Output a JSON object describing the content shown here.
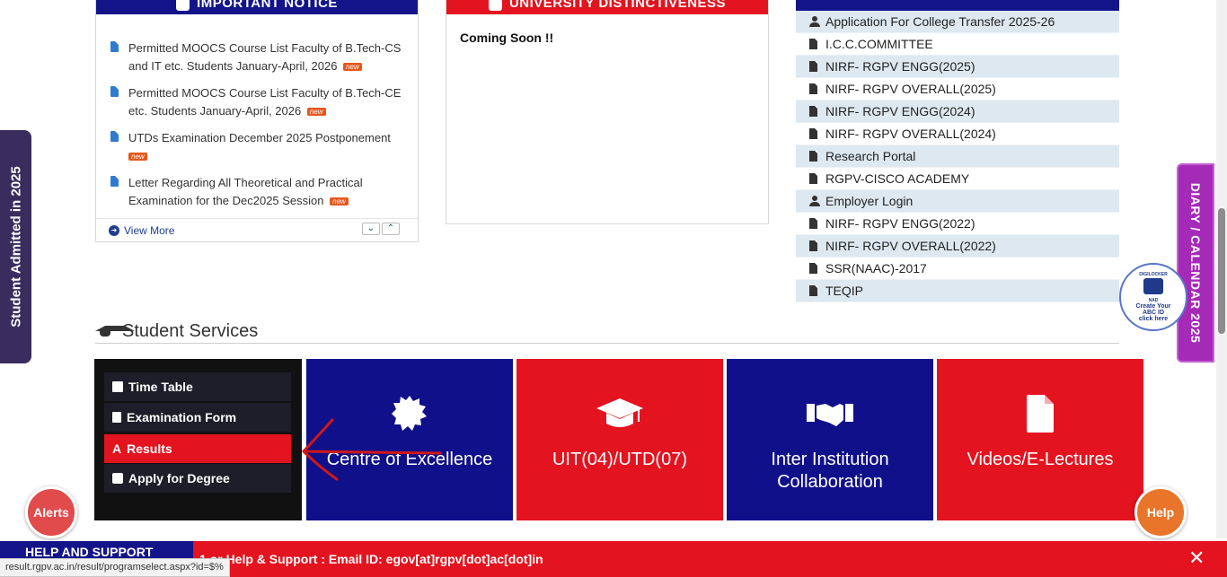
{
  "notice_panel": {
    "title": "IMPORTANT NOTICE",
    "items": [
      {
        "text": "Permitted MOOCS Course List Faculty of B.Tech-CS and IT etc. Students January-April, 2026",
        "badge": "new"
      },
      {
        "text": "Permitted MOOCS Course List Faculty of B.Tech-CE etc. Students January-April, 2026",
        "badge": "new"
      },
      {
        "text": "UTDs Examination December 2025 Postponement",
        "badge": "new"
      },
      {
        "text": "Letter Regarding All Theoretical and Practical Examination for the Dec2025 Session",
        "badge": "new"
      }
    ],
    "view_more": "View More"
  },
  "distinct_panel": {
    "title": "UNIVERSITY DISTINCTIVENESS",
    "content": "Coming Soon !!"
  },
  "links": [
    {
      "label": "Application For College Transfer 2025-26",
      "icon": "user-icon"
    },
    {
      "label": "I.C.C.COMMITTEE",
      "icon": "file-icon"
    },
    {
      "label": "NIRF- RGPV ENGG(2025)",
      "icon": "file-icon"
    },
    {
      "label": "NIRF- RGPV OVERALL(2025)",
      "icon": "file-icon"
    },
    {
      "label": "NIRF- RGPV ENGG(2024)",
      "icon": "file-icon"
    },
    {
      "label": "NIRF- RGPV OVERALL(2024)",
      "icon": "file-icon"
    },
    {
      "label": "Research Portal",
      "icon": "file-icon"
    },
    {
      "label": "RGPV-CISCO ACADEMY",
      "icon": "file-icon"
    },
    {
      "label": "Employer Login",
      "icon": "user-icon"
    },
    {
      "label": "NIRF- RGPV ENGG(2022)",
      "icon": "file-icon"
    },
    {
      "label": "NIRF- RGPV OVERALL(2022)",
      "icon": "file-icon"
    },
    {
      "label": "SSR(NAAC)-2017",
      "icon": "file-icon"
    },
    {
      "label": "TEQIP",
      "icon": "file-icon"
    }
  ],
  "student_services": {
    "title": "Student Services",
    "menu": [
      {
        "label": "Time Table",
        "icon": "calendar-icon",
        "active": false
      },
      {
        "label": "Examination Form",
        "icon": "document-icon",
        "active": false
      },
      {
        "label": "Results",
        "icon": "font-icon",
        "active": true
      },
      {
        "label": "Apply for Degree",
        "icon": "edit-icon",
        "active": false
      }
    ],
    "tiles": [
      {
        "label": "Centre of Excellence",
        "icon": "certificate-icon",
        "color": "#10108a"
      },
      {
        "label": "UIT(04)/UTD(07)",
        "icon": "graduation-cap-icon",
        "color": "#e3131f"
      },
      {
        "label": "Inter Institution Collaboration",
        "icon": "handshake-icon",
        "color": "#10108a"
      },
      {
        "label": "Videos/E-Lectures",
        "icon": "file-icon",
        "color": "#e3131f"
      }
    ]
  },
  "side_tabs": {
    "left": "Student Admitted in 2025",
    "right": "DIARY / CALENDAR 2025"
  },
  "abc_badge": {
    "top_text": "DIGILOCKER",
    "sub_text": "NAD",
    "line1": "Create Your",
    "line2": "ABC ID",
    "line3": "click here"
  },
  "buttons": {
    "alerts": "Alerts",
    "help": "Help"
  },
  "bottom_bar": {
    "left_label": "HELP AND SUPPORT",
    "ticker": "1 or Help & Support : Email ID: egov[at]rgpv[dot]ac[dot]in",
    "close": "✕"
  },
  "status_url": "result.rgpv.ac.in/result/programselect.aspx?id=$%",
  "colors": {
    "navy": "#14148a",
    "red": "#e3131f",
    "purple_tab": "#a52ab8",
    "dark_tab": "#3a2d5e"
  }
}
